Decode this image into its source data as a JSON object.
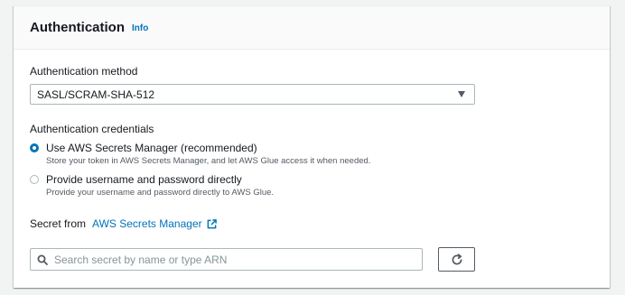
{
  "panel": {
    "title": "Authentication",
    "info_link": "Info"
  },
  "auth_method": {
    "label": "Authentication method",
    "selected": "SASL/SCRAM-SHA-512"
  },
  "credentials": {
    "label": "Authentication credentials",
    "options": [
      {
        "label": "Use AWS Secrets Manager (recommended)",
        "description": "Store your token in AWS Secrets Manager, and let AWS Glue access it when needed.",
        "checked": true
      },
      {
        "label": "Provide username and password directly",
        "description": "Provide your username and password directly to AWS Glue.",
        "checked": false
      }
    ]
  },
  "secret": {
    "label": "Secret from",
    "link": "AWS Secrets Manager",
    "search_placeholder": "Search secret by name or type ARN",
    "search_value": ""
  },
  "icons": {
    "select_caret": "caret-down-icon",
    "external_link": "external-link-icon",
    "search": "search-icon",
    "refresh": "refresh-icon"
  },
  "colors": {
    "link": "#0073bb",
    "radio_selected": "#0073bb",
    "text": "#16191f",
    "secondary_text": "#545b64",
    "page_background": "#f2f3f3"
  }
}
